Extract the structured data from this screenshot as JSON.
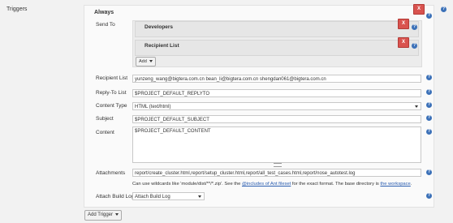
{
  "section_label": "Triggers",
  "trigger": {
    "title": "Always",
    "delete_label": "X"
  },
  "send_to": {
    "label": "Send To",
    "items": [
      {
        "name": "Developers",
        "delete_label": "X"
      },
      {
        "name": "Recipient List",
        "delete_label": "X"
      }
    ],
    "add_label": "Add"
  },
  "fields": {
    "recipient_list": {
      "label": "Recipient List",
      "value": "yunzeng_wang@bigtera.com.cn bean_li@bigtera.com.cn shengdan061@bigtera.com.cn"
    },
    "reply_to": {
      "label": "Reply-To List",
      "value": "$PROJECT_DEFAULT_REPLYTO"
    },
    "content_type": {
      "label": "Content Type",
      "value": "HTML (text/html)"
    },
    "subject": {
      "label": "Subject",
      "value": "$PROJECT_DEFAULT_SUBJECT"
    },
    "content": {
      "label": "Content",
      "value": "$PROJECT_DEFAULT_CONTENT"
    },
    "attachments": {
      "label": "Attachments",
      "value": "report/create_cluster.html,report/setup_cluster.html,report/all_test_cases.html,report/nose_autotest.log"
    },
    "attach_build_log": {
      "label": "Attach Build Log",
      "value": "Attach Build Log"
    }
  },
  "hint": {
    "before": "Can use wildcards like 'module/dist/**/*.zip'. See the ",
    "link1": "@includes of Ant fileset",
    "middle": " for the exact format. The base directory is ",
    "link2": "the workspace",
    "after": "."
  },
  "add_trigger_label": "Add Trigger",
  "help_glyph": "?",
  "colors": {
    "delete": "#d9534f",
    "help": "#3c71b8",
    "link": "#2a5db0"
  }
}
